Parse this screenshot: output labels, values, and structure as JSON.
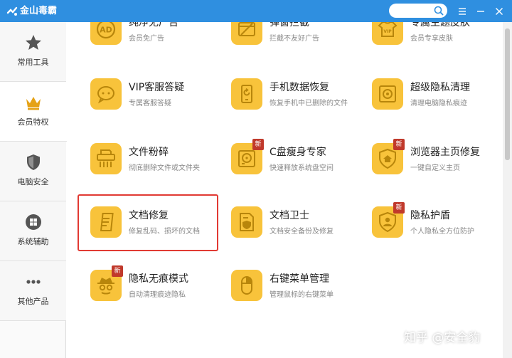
{
  "titlebar": {
    "app_name": "金山毒霸",
    "search_placeholder": ""
  },
  "sidebar": {
    "items": [
      {
        "label": "常用工具",
        "icon": "star-icon"
      },
      {
        "label": "会员特权",
        "icon": "crown-icon"
      },
      {
        "label": "电脑安全",
        "icon": "shield-icon"
      },
      {
        "label": "系统辅助",
        "icon": "windows-icon"
      },
      {
        "label": "其他产品",
        "icon": "more-dots-icon"
      }
    ],
    "active_index": 1
  },
  "tools": [
    {
      "name": "纯净无广告",
      "desc": "会员免广告",
      "icon": "ad-block-icon",
      "new": false
    },
    {
      "name": "弹窗拦截",
      "desc": "拦截不友好广告",
      "icon": "popup-block-icon",
      "new": false
    },
    {
      "name": "专属主题皮肤",
      "desc": "会员专享皮肤",
      "icon": "vip-skin-icon",
      "new": false
    },
    {
      "name": "VIP客服答疑",
      "desc": "专属客服答疑",
      "icon": "customer-service-icon",
      "new": false
    },
    {
      "name": "手机数据恢复",
      "desc": "恢复手机中已删除的文件",
      "icon": "phone-recovery-icon",
      "new": false
    },
    {
      "name": "超级隐私清理",
      "desc": "清理电脑隐私痕迹",
      "icon": "privacy-safe-icon",
      "new": false
    },
    {
      "name": "文件粉碎",
      "desc": "彻底删除文件或文件夹",
      "icon": "file-shredder-icon",
      "new": false
    },
    {
      "name": "C盘瘦身专家",
      "desc": "快速释放系统盘空间",
      "icon": "disk-slim-icon",
      "new": true
    },
    {
      "name": "浏览器主页修复",
      "desc": "一键自定义主页",
      "icon": "browser-home-icon",
      "new": true
    },
    {
      "name": "文档修复",
      "desc": "修复乱码、损坏的文档",
      "icon": "document-repair-icon",
      "new": false
    },
    {
      "name": "文档卫士",
      "desc": "文档安全备份及修复",
      "icon": "document-guard-icon",
      "new": false
    },
    {
      "name": "隐私护盾",
      "desc": "个人隐私全方位防护",
      "icon": "privacy-shield-icon",
      "new": true
    },
    {
      "name": "隐私无痕模式",
      "desc": "自动清理痕迹隐私",
      "icon": "incognito-icon",
      "new": true
    },
    {
      "name": "右键菜单管理",
      "desc": "管理鼠标的右键菜单",
      "icon": "mouse-menu-icon",
      "new": false
    }
  ],
  "badge_label": "新",
  "watermark": "知乎 @安全豹",
  "colors": {
    "titlebar": "#2f8fe0",
    "tile_icon": "#f8c33b",
    "icon_fg": "#b8860b",
    "highlight": "#e13a33",
    "badge": "#c0392b"
  }
}
